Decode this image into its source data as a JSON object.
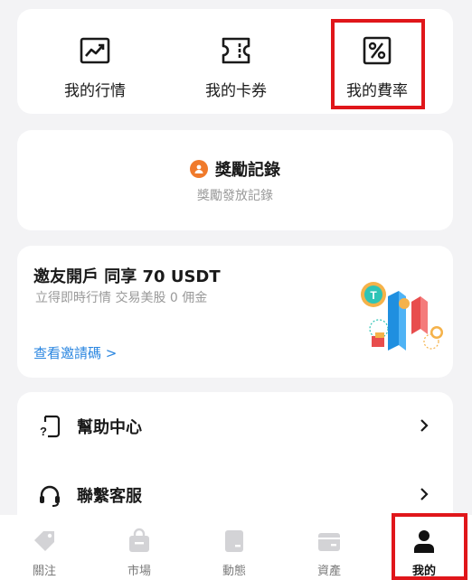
{
  "quick_actions": [
    {
      "label": "我的行情",
      "icon": "trend-chart-icon"
    },
    {
      "label": "我的卡券",
      "icon": "ticket-icon"
    },
    {
      "label": "我的費率",
      "icon": "percent-icon"
    }
  ],
  "rewards": {
    "title": "獎勵記錄",
    "subtitle": "獎勵發放記錄",
    "icon": "user-badge-icon",
    "icon_color": "#f07a2b"
  },
  "invite": {
    "title": "邀友開戶 同享 70 USDT",
    "subtitle": "立得即時行情 交易美股 0 佣金",
    "link": "查看邀請碼 >",
    "link_color": "#2a86e0"
  },
  "menu": [
    {
      "label": "幫助中心",
      "icon": "help-document-icon"
    },
    {
      "label": "聯繫客服",
      "icon": "headset-icon"
    }
  ],
  "bottom_nav": [
    {
      "label": "關注",
      "icon": "tag-icon",
      "active": false
    },
    {
      "label": "市場",
      "icon": "bag-icon",
      "active": false
    },
    {
      "label": "動態",
      "icon": "post-icon",
      "active": false
    },
    {
      "label": "資產",
      "icon": "wallet-icon",
      "active": false
    },
    {
      "label": "我的",
      "icon": "person-icon",
      "active": true
    }
  ],
  "colors": {
    "highlight": "#e0161a",
    "page_background": "#f3f3f5"
  }
}
